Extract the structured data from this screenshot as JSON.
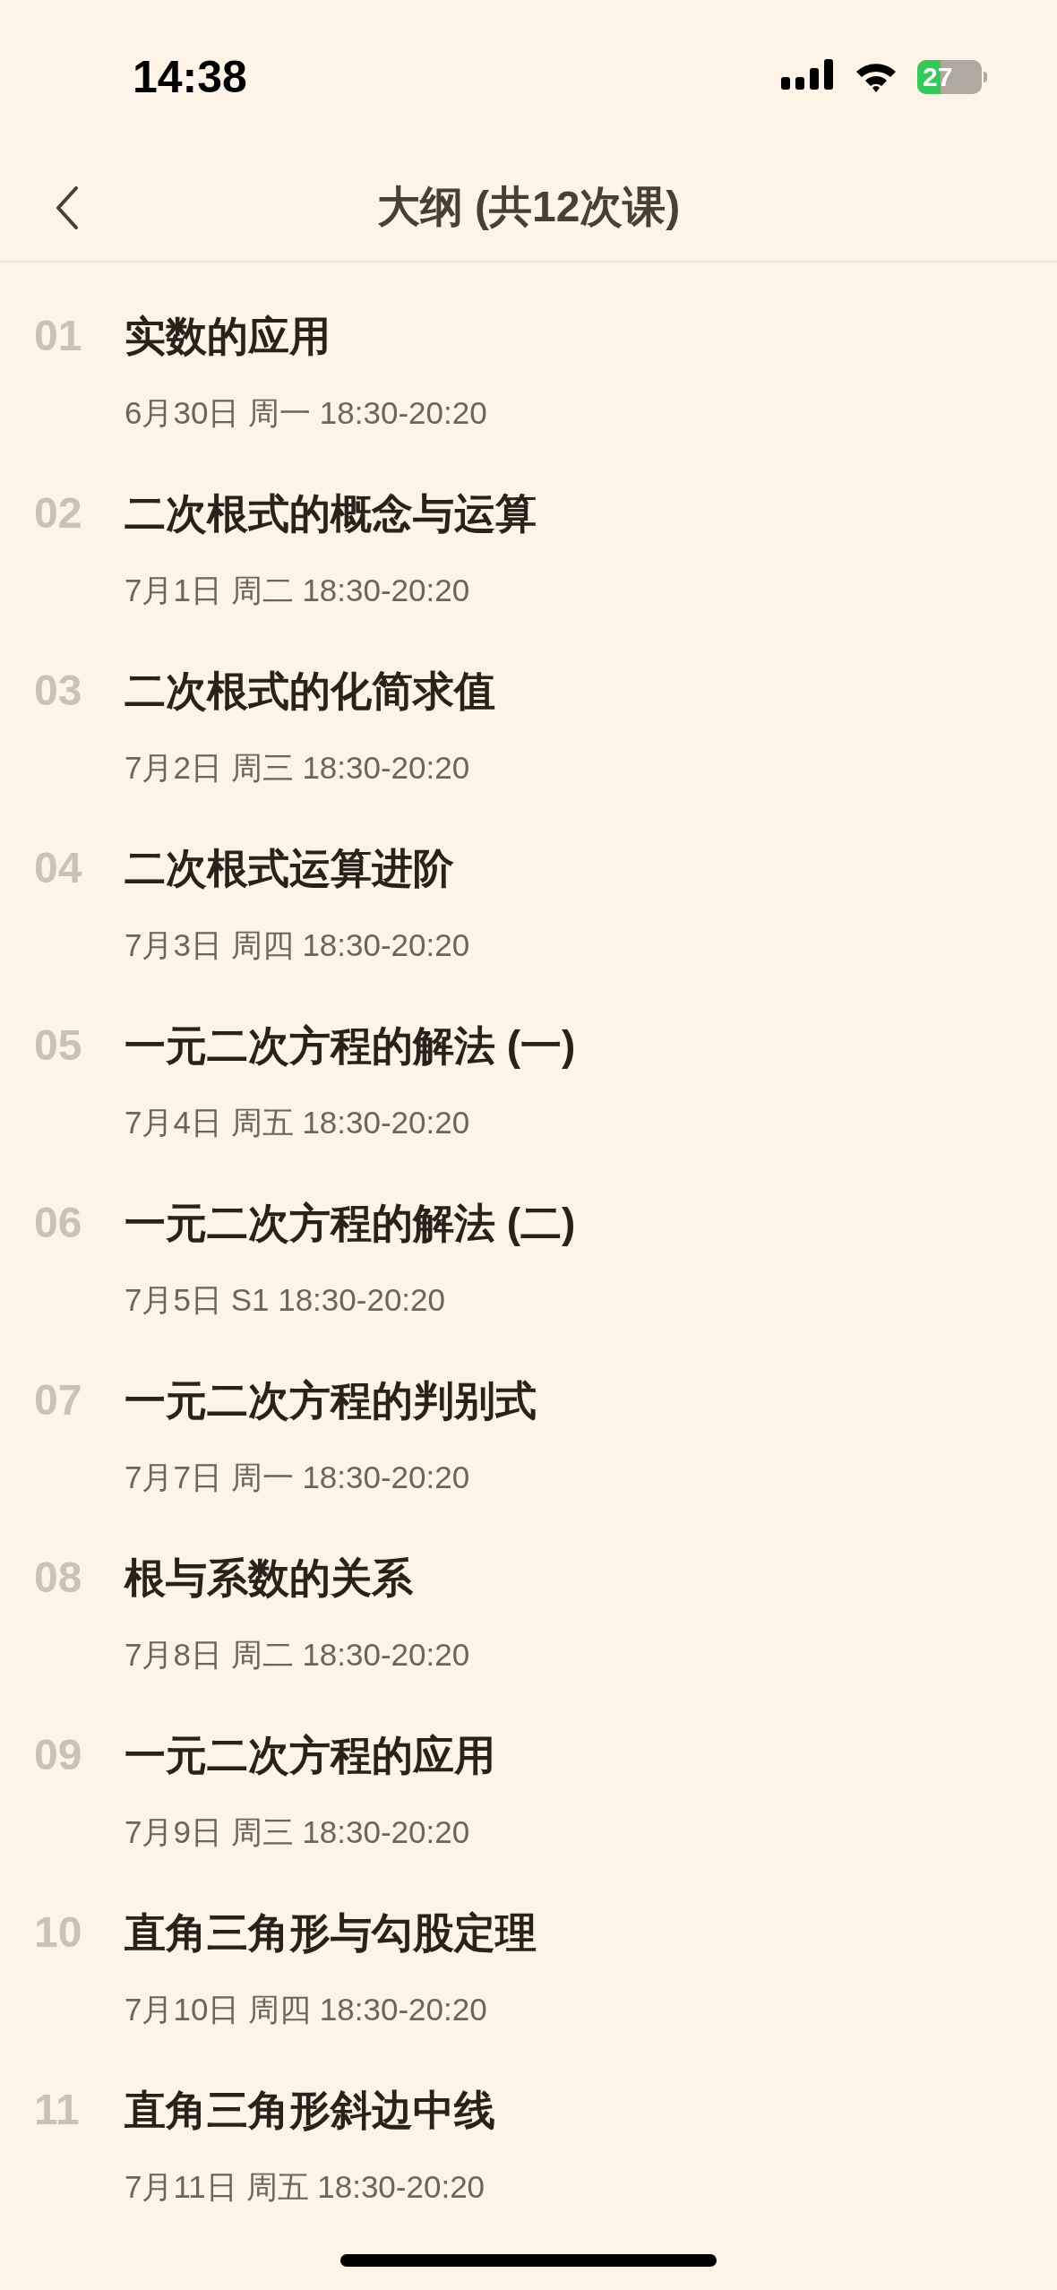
{
  "status_bar": {
    "time": "14:38",
    "battery": "27"
  },
  "header": {
    "title": "大纲 (共12次课)"
  },
  "lessons": [
    {
      "number": "01",
      "title": "实数的应用",
      "schedule": "6月30日 周一 18:30-20:20"
    },
    {
      "number": "02",
      "title": "二次根式的概念与运算",
      "schedule": "7月1日 周二 18:30-20:20"
    },
    {
      "number": "03",
      "title": "二次根式的化简求值",
      "schedule": "7月2日 周三 18:30-20:20"
    },
    {
      "number": "04",
      "title": "二次根式运算进阶",
      "schedule": "7月3日 周四 18:30-20:20"
    },
    {
      "number": "05",
      "title": "一元二次方程的解法 (一)",
      "schedule": "7月4日 周五 18:30-20:20"
    },
    {
      "number": "06",
      "title": "一元二次方程的解法 (二)",
      "schedule": "7月5日 S1 18:30-20:20"
    },
    {
      "number": "07",
      "title": "一元二次方程的判别式",
      "schedule": "7月7日 周一 18:30-20:20"
    },
    {
      "number": "08",
      "title": "根与系数的关系",
      "schedule": "7月8日 周二 18:30-20:20"
    },
    {
      "number": "09",
      "title": "一元二次方程的应用",
      "schedule": "7月9日 周三 18:30-20:20"
    },
    {
      "number": "10",
      "title": "直角三角形与勾股定理",
      "schedule": "7月10日 周四 18:30-20:20"
    },
    {
      "number": "11",
      "title": "直角三角形斜边中线",
      "schedule": "7月11日 周五 18:30-20:20"
    }
  ]
}
